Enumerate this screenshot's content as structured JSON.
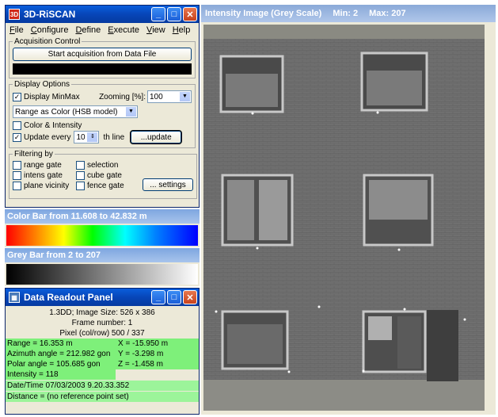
{
  "main_window": {
    "title": "3D-RiSCAN",
    "menu": [
      "File",
      "Configure",
      "Define",
      "Execute",
      "View",
      "Help"
    ],
    "acquisition": {
      "legend": "Acquisition Control",
      "start_button": "Start acquisition from Data File"
    },
    "display": {
      "legend": "Display Options",
      "display_minmax": "Display MinMax",
      "zooming_label": "Zooming [%]:",
      "zooming_value": "100",
      "color_mode": "Range as Color (HSB model)",
      "color_intensity": "Color & Intensity",
      "update_every": "Update every",
      "update_value": "10",
      "th_line": "th line",
      "update_button": "...update"
    },
    "filtering": {
      "legend": "Filtering by",
      "range_gate": "range gate",
      "selection": "selection",
      "intens_gate": "intens gate",
      "cube_gate": "cube gate",
      "plane_vicinity": "plane vicinity",
      "fence_gate": "fence gate",
      "settings_button": "... settings"
    }
  },
  "color_bar": {
    "title": "Color Bar from   11.608 to   42.832 m"
  },
  "grey_bar": {
    "title": "Grey Bar from   2 to 207"
  },
  "readout": {
    "title": "Data Readout Panel",
    "line1": "1.3DD; Image Size: 526 x 386",
    "line2": "Frame number:  1",
    "line3": "Pixel (col/row) 500 / 337",
    "range": "Range =  16.353 m",
    "x": "X =  -15.950 m",
    "azimuth": "Azimuth angle = 212.982 gon",
    "y": "Y =   -3.298 m",
    "polar": "Polar angle = 105.685 gon",
    "z": "Z =   -1.458 m",
    "intensity": "Intensity =    118",
    "datetime": "Date/Time 07/03/2003 9.20.33.352",
    "distance": "Distance = (no reference point set)"
  },
  "image_window": {
    "title": "Intensity Image (Grey Scale)",
    "min": "Min:  2",
    "max": "Max:  207"
  }
}
